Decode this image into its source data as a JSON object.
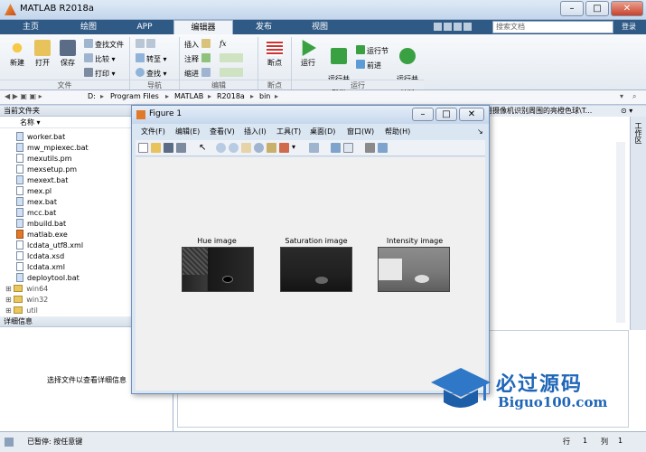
{
  "window": {
    "title": "MATLAB R2018a"
  },
  "tabs": [
    "主页",
    "绘图",
    "APP",
    "编辑器",
    "发布",
    "视图"
  ],
  "active_tab": "编辑器",
  "search": {
    "placeholder": "搜索文档",
    "login": "登录"
  },
  "ribbon": {
    "file": {
      "new": "新建",
      "open": "打开",
      "save": "保存",
      "find_files": "查找文件",
      "compare": "比较",
      "print": "打印",
      "group": "文件"
    },
    "navigate": {
      "goto": "转至",
      "find": "查找",
      "group": "导航"
    },
    "edit": {
      "insert": "插入",
      "comment": "注释",
      "indent": "缩进",
      "fx": "fx",
      "group": "编辑"
    },
    "breakpoints": {
      "label": "断点",
      "group": "断点"
    },
    "run": {
      "run": "运行",
      "run_advance": "运行并\n前进",
      "run_section": "运行节",
      "advance": "前进",
      "run_time": "运行并\n计时",
      "group": "运行"
    }
  },
  "address": {
    "path": [
      "D:",
      "Program Files",
      "MATLAB",
      "R2018a",
      "bin"
    ]
  },
  "current_folder": {
    "title": "当前文件夹",
    "column": "名称",
    "files": [
      "worker.bat",
      "mw_mpiexec.bat",
      "mexutils.pm",
      "mexsetup.pm",
      "mexext.bat",
      "mex.pl",
      "mex.bat",
      "mcc.bat",
      "mbuild.bat",
      "matlab.exe",
      "lcdata_utf8.xml",
      "lcdata.xsd",
      "lcdata.xml",
      "deploytool.bat"
    ],
    "folders": [
      "win64",
      "win32",
      "util"
    ]
  },
  "details": {
    "title": "详细信息",
    "hint": "选择文件以查看详细信息"
  },
  "right_header": "用摄像机识别周围的亮橙色球\\T...",
  "right_tab": "工作区",
  "status": {
    "left": "已暂停: 按任意键",
    "row_label": "行",
    "row": "1",
    "col_label": "列",
    "col": "1"
  },
  "figure": {
    "title": "Figure 1",
    "menu": [
      "文件(F)",
      "编辑(E)",
      "查看(V)",
      "插入(I)",
      "工具(T)",
      "桌面(D)",
      "窗口(W)",
      "帮助(H)"
    ],
    "images": [
      {
        "title": "Hue image"
      },
      {
        "title": "Saturation image"
      },
      {
        "title": "Intensity image"
      }
    ]
  },
  "watermark": {
    "brand": "必过源码",
    "url": "Biguo100.com"
  }
}
